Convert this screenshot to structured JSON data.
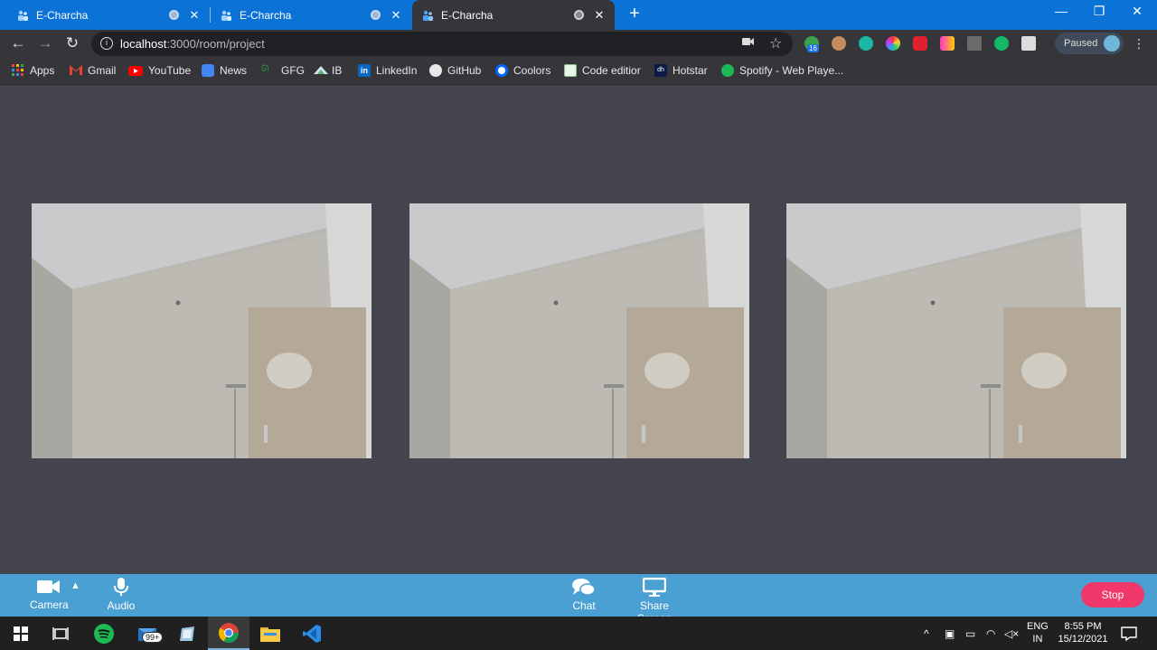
{
  "browser": {
    "tabs": [
      {
        "title": "E-Charcha"
      },
      {
        "title": "E-Charcha"
      },
      {
        "title": "E-Charcha"
      }
    ],
    "url_host": "localhost",
    "url_path": ":3000/room/project",
    "extension_badge": "16",
    "profile_status": "Paused"
  },
  "bookmarks": [
    {
      "label": "Apps",
      "icon": "apps-grid-icon"
    },
    {
      "label": "Gmail",
      "icon": "gmail-icon"
    },
    {
      "label": "YouTube",
      "icon": "youtube-icon"
    },
    {
      "label": "News",
      "icon": "news-icon"
    },
    {
      "label": "GFG",
      "icon": "gfg-icon"
    },
    {
      "label": "IB",
      "icon": "ib-icon"
    },
    {
      "label": "LinkedIn",
      "icon": "linkedin-icon"
    },
    {
      "label": "GitHub",
      "icon": "github-icon"
    },
    {
      "label": "Coolors",
      "icon": "coolors-icon"
    },
    {
      "label": "Code editior",
      "icon": "code-editor-icon"
    },
    {
      "label": "Hotstar",
      "icon": "hotstar-icon"
    },
    {
      "label": "Spotify - Web Playe...",
      "icon": "spotify-icon"
    }
  ],
  "videos": [
    {
      "name": "video-tile-1"
    },
    {
      "name": "video-tile-2"
    },
    {
      "name": "video-tile-3"
    }
  ],
  "controls": {
    "camera": "Camera",
    "audio": "Audio",
    "chat": "Chat",
    "share_screen": "Share Screen",
    "stop": "Stop"
  },
  "taskbar": {
    "mail_badge": "99+",
    "lang_1": "ENG",
    "lang_2": "IN",
    "time": "8:55 PM",
    "date": "15/12/2021"
  },
  "colors": {
    "tab_strip": "#0b72d6",
    "control_bar": "#4a9fd3",
    "stop_button": "#f0386b",
    "stage": "#44444f"
  }
}
